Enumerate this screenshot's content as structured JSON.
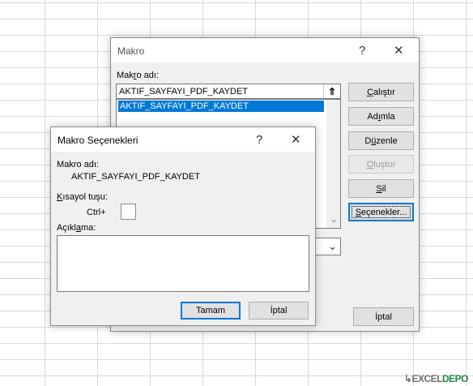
{
  "macro_dialog": {
    "title": "Makro",
    "help_glyph": "?",
    "close_glyph": "✕",
    "name_label_pre": "Mak",
    "name_label_ul": "r",
    "name_label_post": "o adı:",
    "name_value": "AKTIF_SAYFAYI_PDF_KAYDET",
    "upload_glyph": "⇑",
    "list_items": [
      "AKTIF_SAYFAYI_PDF_KAYDET"
    ],
    "buttons": {
      "run": {
        "pre": "",
        "ul": "Ç",
        "post": "alıştır"
      },
      "step": {
        "pre": "Ad",
        "ul": "ı",
        "post": "mla"
      },
      "edit": {
        "pre": "D",
        "ul": "ü",
        "post": "zenle"
      },
      "create": {
        "pre": "",
        "ul": "O",
        "post": "luştur"
      },
      "delete": {
        "pre": "",
        "ul": "S",
        "post": "il"
      },
      "options": {
        "pre": "",
        "ul": "S",
        "post": "eçenekler..."
      },
      "cancel": {
        "label": "İptal"
      }
    },
    "scroll_down_glyph": "⌄",
    "dropdown_glyph": "⌄"
  },
  "options_dialog": {
    "title": "Makro Seçenekleri",
    "help_glyph": "?",
    "close_glyph": "✕",
    "name_label": "Makro adı:",
    "name_value": "AKTIF_SAYFAYI_PDF_KAYDET",
    "shortcut_label_ul": "K",
    "shortcut_label_post": "ısayol tuşu:",
    "ctrl_label": "Ctrl+",
    "shortcut_value": "",
    "desc_label_pre": "Açıkl",
    "desc_label_ul": "a",
    "desc_label_post": "ma:",
    "desc_value": "",
    "ok_label": "Tamam",
    "cancel_label": "İptal"
  },
  "watermark": {
    "prefix": "↳",
    "main": "EXCEL",
    "accent": "DEPO"
  }
}
